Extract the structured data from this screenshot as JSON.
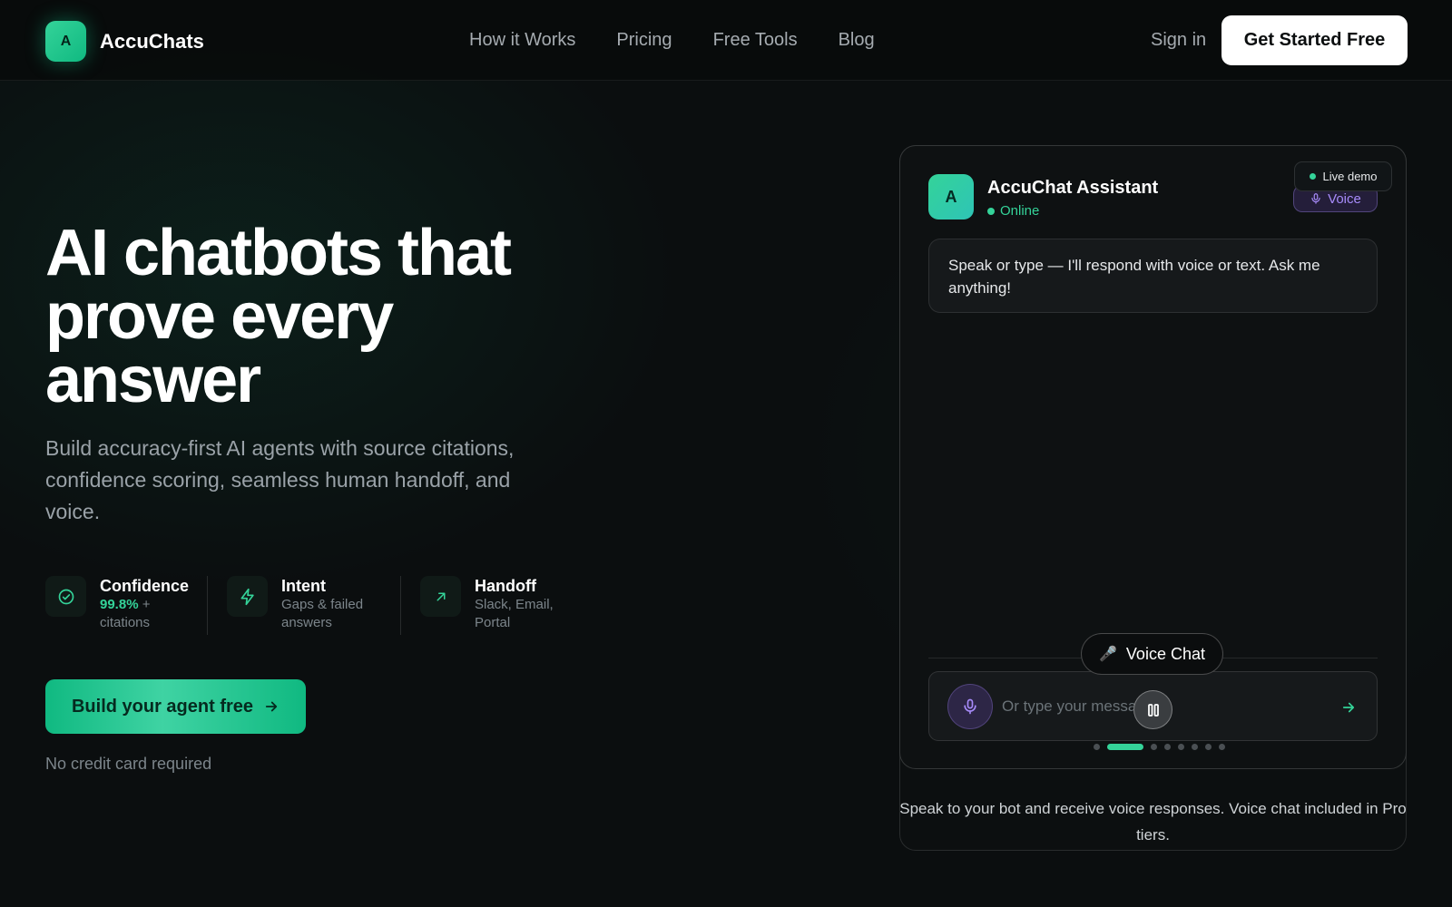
{
  "brand": {
    "mark": "A",
    "name": "AccuChats"
  },
  "nav": {
    "links": [
      "How it Works",
      "Pricing",
      "Free Tools",
      "Blog"
    ],
    "signin": "Sign in",
    "cta": "Get Started Free"
  },
  "hero": {
    "title_line1": "AI chatbots that",
    "title_line2": "prove every",
    "title_line3": "answer",
    "subtitle": "Build accuracy-first AI agents with source citations, confidence scoring, seamless human handoff, and voice.",
    "stats": [
      {
        "title": "Confidence",
        "accent": "99.8%",
        "desc_after": " + citations",
        "icon": "check-circle-icon"
      },
      {
        "title": "Intent",
        "desc": "Gaps & failed answers",
        "icon": "bolt-icon"
      },
      {
        "title": "Handoff",
        "desc": "Slack, Email, Portal",
        "icon": "arrow-up-right-icon"
      }
    ],
    "cta": "Build your agent free",
    "note": "No credit card required"
  },
  "demo": {
    "live_badge": "Live demo",
    "voice_badge": "Voice",
    "avatar": "A",
    "assistant_name": "AccuChat Assistant",
    "status": "Online",
    "bot_message": "Speak or type — I'll respond with voice or text. Ask me anything!",
    "voice_chat_pill": "Voice Chat",
    "voice_chat_glyph": "🎤",
    "input_placeholder": "Or type your message...",
    "carousel": {
      "count": 8,
      "active_index": 1
    },
    "caption": "Speak to your bot and receive voice responses. Voice chat included in Pro tiers."
  },
  "colors": {
    "accent": "#34d399",
    "accent_dark": "#10b981",
    "voice": "#a78bfa",
    "bg": "#0b0e0f"
  }
}
